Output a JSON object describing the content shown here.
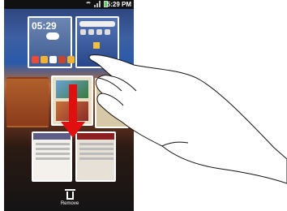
{
  "status_bar": {
    "time": "5:29 PM"
  },
  "home_panels": {
    "clock": "05:29"
  },
  "bottom_action": {
    "label": "Remove",
    "icon": "trash-icon"
  },
  "colors": {
    "arrow": "#e01010",
    "panel_border": "#ffffff"
  }
}
